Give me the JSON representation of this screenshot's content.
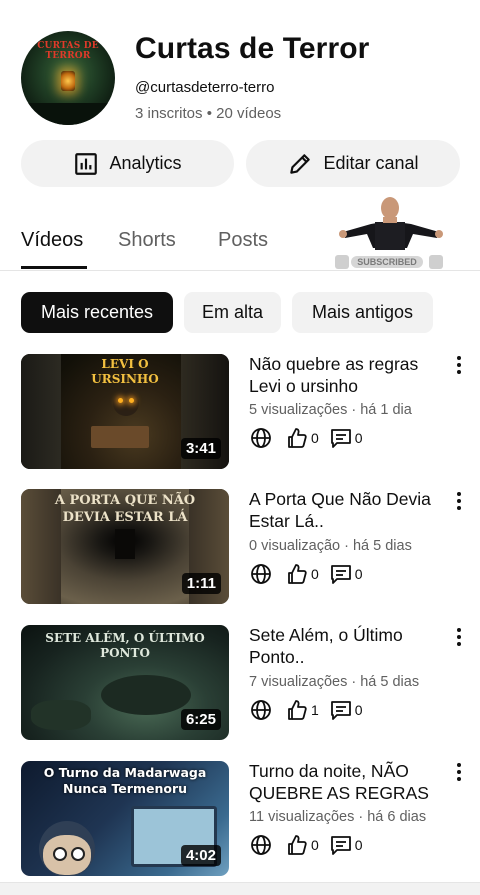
{
  "channel": {
    "avatar_text": "CURTAS DE TERROR",
    "name": "Curtas de Terror",
    "handle": "@curtasdeterro-terro",
    "stats": "3 inscritos • 20 vídeos"
  },
  "actions": {
    "analytics_label": "Analytics",
    "edit_label": "Editar canal"
  },
  "tabs": [
    {
      "label": "Vídeos",
      "active": true
    },
    {
      "label": "Shorts",
      "active": false
    },
    {
      "label": "Posts",
      "active": false
    }
  ],
  "promo": {
    "badge": "SUBSCRIBED"
  },
  "chips": [
    {
      "label": "Mais recentes",
      "active": true
    },
    {
      "label": "Em alta",
      "active": false
    },
    {
      "label": "Mais antigos",
      "active": false
    }
  ],
  "videos": [
    {
      "thumb_text": "LEVI O URSINHO",
      "duration": "3:41",
      "title": "Não quebre as regras Levi o ursinho",
      "views": "5 visualizações",
      "age": "há 1 dia",
      "likes": "0",
      "comments": "0"
    },
    {
      "thumb_text": "A PORTA QUE NÃO DEVIA ESTAR LÁ",
      "duration": "1:11",
      "title": "A Porta Que Não Devia Estar Lá..",
      "views": "0 visualização",
      "age": "há 5 dias",
      "likes": "0",
      "comments": "0"
    },
    {
      "thumb_text": "SETE ALÉM, O ÚLTIMO PONTO",
      "duration": "6:25",
      "title": "Sete Além, o Último Ponto..",
      "views": "7 visualizações",
      "age": "há 5 dias",
      "likes": "1",
      "comments": "0"
    },
    {
      "thumb_text": "O Turno da Madarwaga Nunca Termenoru",
      "duration": "4:02",
      "title": "Turno da noite, NÃO QUEBRE AS REGRAS",
      "views": "11 visualizações",
      "age": "há 6 dias",
      "likes": "0",
      "comments": "0"
    }
  ],
  "icons": {
    "visibility": "globe-icon",
    "like": "thumbs-up-icon",
    "comment": "comment-icon",
    "more": "more-vert-icon"
  }
}
